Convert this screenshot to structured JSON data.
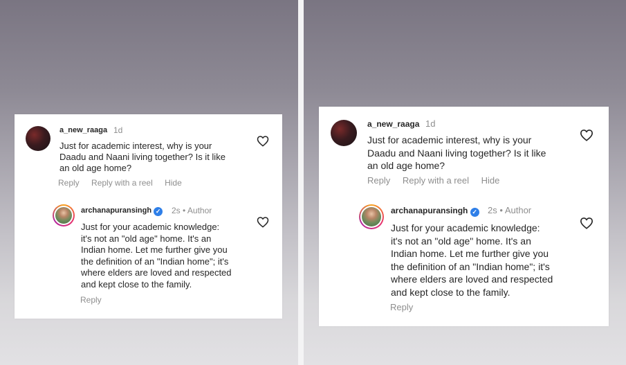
{
  "comment": {
    "username": "a_new_raaga",
    "time": "1d",
    "text_lines": [
      "Just for academic interest, why is your",
      "Daadu and Naani living together? Is it like",
      "an old age home?"
    ],
    "actions": [
      "Reply",
      "Reply with a reel",
      "Hide"
    ],
    "like_icon": "heart-outline-icon"
  },
  "reply": {
    "username": "archanapuransingh",
    "verified_icon": "verified-badge-icon",
    "time": "2s",
    "separator": "•",
    "author_tag": "Author",
    "text_lines": [
      "Just for your academic knowledge:",
      "it's not an \"old age\" home. It's an",
      "Indian home. Let me further give you",
      "the definition of an \"Indian home\"; it's",
      "where elders are loved and respected",
      "and kept close to the family."
    ],
    "actions": [
      "Reply"
    ],
    "like_icon": "heart-outline-icon"
  },
  "colors": {
    "text": "#262626",
    "muted": "#8e8e8e",
    "verified": "#2f7fe8",
    "card": "#ffffff"
  }
}
